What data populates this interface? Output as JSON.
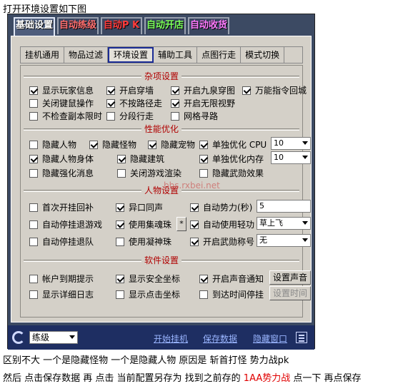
{
  "intro": "打开环境设置如下图",
  "main_tabs": [
    {
      "label": "基础设置",
      "color": "#ffffff"
    },
    {
      "label": "自动练级",
      "color": "#ff6f6f"
    },
    {
      "label": "自动P K",
      "color": "#ff3b3b"
    },
    {
      "label": "自动开店",
      "color": "#7cff5a"
    },
    {
      "label": "自动收货",
      "color": "#ff7bff"
    }
  ],
  "sub_tabs": [
    "挂机通用",
    "物品过滤",
    "环境设置",
    "辅助工具",
    "点图行走",
    "模式切换"
  ],
  "sections": {
    "misc": {
      "title": "杂项设置",
      "items": [
        {
          "label": "显示玩家信息",
          "checked": true
        },
        {
          "label": "开启穿墙",
          "checked": true
        },
        {
          "label": "开启九泉穿图",
          "checked": true
        },
        {
          "label": "万能指令回城",
          "checked": true
        },
        {
          "label": "关闭键鼠操作",
          "checked": false
        },
        {
          "label": "不按路径走",
          "checked": true
        },
        {
          "label": "开启无限视野",
          "checked": true
        },
        {
          "label": "不检查副本限时",
          "checked": false
        },
        {
          "label": "分段行走",
          "checked": false
        },
        {
          "label": "网格寻路",
          "checked": false
        }
      ]
    },
    "perf": {
      "title": "性能优化",
      "items": [
        {
          "label": "隐藏人物",
          "checked": false
        },
        {
          "label": "隐藏怪物",
          "checked": true
        },
        {
          "label": "隐藏宠物",
          "checked": true
        },
        {
          "label": "单独优化 CPU",
          "checked": true
        },
        {
          "label": "隐藏人物身体",
          "checked": true
        },
        {
          "label": "隐藏建筑",
          "checked": true
        },
        {
          "label": "单独优化内存",
          "checked": true
        },
        {
          "label": "隐藏强化消息",
          "checked": false
        },
        {
          "label": "关闭游戏渲染",
          "checked": false
        },
        {
          "label": "隐藏武勋效果",
          "checked": false
        }
      ],
      "cpu_value": "10",
      "mem_value": "10"
    },
    "char": {
      "title": "人物设置",
      "items": [
        {
          "label": "首次开挂回补",
          "checked": false
        },
        {
          "label": "异口同声",
          "checked": true
        },
        {
          "label": "自动势力(秒)",
          "checked": true
        },
        {
          "label": "自动停挂退游戏",
          "checked": false
        },
        {
          "label": "使用集魂珠",
          "checked": true
        },
        {
          "label": "自动使用轻功",
          "checked": true
        },
        {
          "label": "自动停挂退队",
          "checked": false
        },
        {
          "label": "使用凝神珠",
          "checked": false
        },
        {
          "label": "开启武勋称号",
          "checked": true
        }
      ],
      "star": "*",
      "power_value": "5",
      "qinggong_value": "草上飞",
      "title_value": "无"
    },
    "soft": {
      "title": "软件设置",
      "items": [
        {
          "label": "帐户到期提示",
          "checked": false
        },
        {
          "label": "显示安全坐标",
          "checked": true
        },
        {
          "label": "开启声音通知",
          "checked": true
        },
        {
          "label": "显示详细日志",
          "checked": false
        },
        {
          "label": "显示点击坐标",
          "checked": false
        },
        {
          "label": "到达时间停挂",
          "checked": false
        }
      ],
      "btn_sound": "设置声音",
      "btn_time": "设置时间"
    }
  },
  "watermark": "bbs.rxbei.net",
  "footer": {
    "mode_value": "练级",
    "start": "开始挂机",
    "save": "保存数据",
    "hide": "隐藏窗口"
  },
  "para1": "区别不大 一个是隐藏怪物 一个是隐藏人物 原因是 斩首打怪 势力战pk",
  "para2_a": "然后 点击保存数据 再 点击 当前配置另存为 找到之前存的 ",
  "para2_red": "1AA势力战",
  "para2_b": " 点一下 再点保存"
}
